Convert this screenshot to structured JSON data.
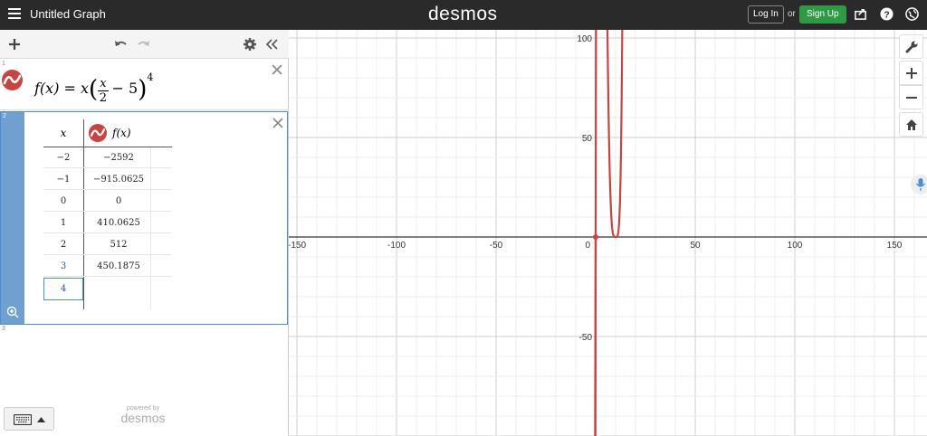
{
  "header": {
    "title": "Untitled Graph",
    "brand": "desmos",
    "login_label": "Log In",
    "or_label": "or",
    "signup_label": "Sign Up",
    "signup_color": "#2f9a46"
  },
  "expressions": [
    {
      "number": "1",
      "formula": {
        "lhs": "f(x) = x",
        "num": "x",
        "den": "2",
        "minus": "− 5",
        "exp": "4"
      }
    },
    {
      "number": "2",
      "table": {
        "headers": {
          "x": "x",
          "y": "f(x)"
        },
        "rows": [
          {
            "x": "−2",
            "y": "−2592"
          },
          {
            "x": "−1",
            "y": "−915.0625"
          },
          {
            "x": "0",
            "y": "0"
          },
          {
            "x": "1",
            "y": "410.0625"
          },
          {
            "x": "2",
            "y": "512"
          },
          {
            "x": "3",
            "y": "450.1875"
          },
          {
            "x": "4",
            "y": ""
          }
        ]
      }
    },
    {
      "number": "3"
    }
  ],
  "footer": {
    "powered_by": "powered by",
    "brand": "desmos"
  },
  "graph": {
    "x_ticks": [
      "-150",
      "-100",
      "-50",
      "0",
      "50",
      "100",
      "150"
    ],
    "y_ticks": [
      "100",
      "50",
      "-50"
    ],
    "curve_color": "#c74440"
  }
}
